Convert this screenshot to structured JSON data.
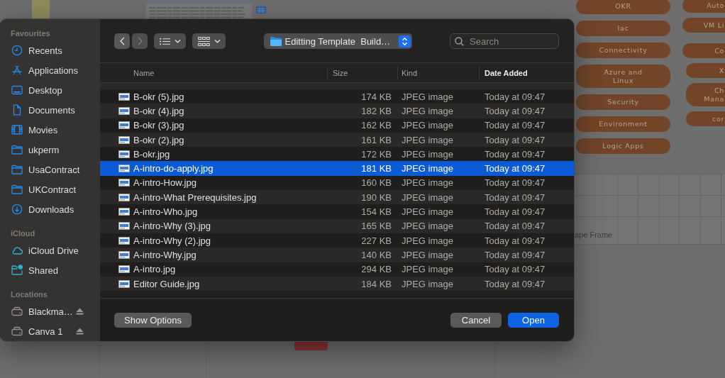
{
  "canvas": {
    "tags": [
      "OKR",
      "Iac",
      "Connectivity",
      "Azure and Linux",
      "Security",
      "Environment",
      "Logic Apps"
    ],
    "cut_tags": [
      "Auto",
      "VM Li",
      "Co",
      "X",
      "Ch Mana",
      "cor"
    ],
    "frame_label": "ape Frame"
  },
  "dialog": {
    "sidebar": [
      {
        "title": "Favourites",
        "items": [
          {
            "label": "Recents",
            "kind": "recents",
            "selected": false
          },
          {
            "label": "Applications",
            "kind": "applications",
            "selected": false
          },
          {
            "label": "Desktop",
            "kind": "desktop",
            "selected": false
          },
          {
            "label": "Documents",
            "kind": "documents",
            "selected": false
          },
          {
            "label": "Movies",
            "kind": "movies",
            "selected": false
          },
          {
            "label": "ukperm",
            "kind": "folder",
            "selected": false
          },
          {
            "label": "UsaContract",
            "kind": "folder",
            "selected": false
          },
          {
            "label": "UKContract",
            "kind": "folder",
            "selected": false
          },
          {
            "label": "Downloads",
            "kind": "downloads",
            "selected": false
          }
        ]
      },
      {
        "title": "iCloud",
        "items": [
          {
            "label": "iCloud Drive",
            "kind": "cloud",
            "selected": false
          },
          {
            "label": "Shared",
            "kind": "shared",
            "selected": false
          }
        ]
      },
      {
        "title": "Locations",
        "items": [
          {
            "label": "Blackma…",
            "kind": "drive",
            "selected": false
          },
          {
            "label": "Canva 1",
            "kind": "drive",
            "selected": false
          }
        ]
      }
    ],
    "toolbar": {
      "navigation": [
        {
          "kind": "back",
          "disabled": false
        },
        {
          "kind": "forward",
          "disabled": true
        }
      ],
      "location": "Editting Template  Build…",
      "search": {
        "placeholder": "Search"
      }
    },
    "columns": [
      {
        "label": "Name",
        "sorted": false
      },
      {
        "label": "Size",
        "sorted": false
      },
      {
        "label": "Kind",
        "sorted": false
      },
      {
        "label": "Date Added",
        "sorted": true
      }
    ],
    "rows": [
      {
        "name": "B-okr (5).jpg",
        "size": "174 KB",
        "kind": "JPEG image",
        "date": "Today at 09:47",
        "selected": false
      },
      {
        "name": "B-okr (4).jpg",
        "size": "182 KB",
        "kind": "JPEG image",
        "date": "Today at 09:47",
        "selected": false
      },
      {
        "name": "B-okr (3).jpg",
        "size": "162 KB",
        "kind": "JPEG image",
        "date": "Today at 09:47",
        "selected": false
      },
      {
        "name": "B-okr (2).jpg",
        "size": "161 KB",
        "kind": "JPEG image",
        "date": "Today at 09:47",
        "selected": false
      },
      {
        "name": "B-okr.jpg",
        "size": "172 KB",
        "kind": "JPEG image",
        "date": "Today at 09:47",
        "selected": false
      },
      {
        "name": "A-intro-do-apply.jpg",
        "size": "181 KB",
        "kind": "JPEG image",
        "date": "Today at 09:47",
        "selected": true
      },
      {
        "name": "A-intro-How.jpg",
        "size": "160 KB",
        "kind": "JPEG image",
        "date": "Today at 09:47",
        "selected": false
      },
      {
        "name": "A-intro-What Prerequisites.jpg",
        "size": "190 KB",
        "kind": "JPEG image",
        "date": "Today at 09:47",
        "selected": false
      },
      {
        "name": "A-intro-Who.jpg",
        "size": "154 KB",
        "kind": "JPEG image",
        "date": "Today at 09:47",
        "selected": false
      },
      {
        "name": "A-intro-Why (3).jpg",
        "size": "165 KB",
        "kind": "JPEG image",
        "date": "Today at 09:47",
        "selected": false
      },
      {
        "name": "A-intro-Why (2).jpg",
        "size": "227 KB",
        "kind": "JPEG image",
        "date": "Today at 09:47",
        "selected": false
      },
      {
        "name": "A-intro-Why.jpg",
        "size": "140 KB",
        "kind": "JPEG image",
        "date": "Today at 09:47",
        "selected": false
      },
      {
        "name": "A-intro.jpg",
        "size": "294 KB",
        "kind": "JPEG image",
        "date": "Today at 09:47",
        "selected": false
      },
      {
        "name": "Editor Guide.jpg",
        "size": "184 KB",
        "kind": "JPEG image",
        "date": "Today at 09:47",
        "selected": false
      }
    ],
    "footer": {
      "options_button": "Show Options",
      "buttons": [
        {
          "label": "Cancel",
          "kind": "plain"
        },
        {
          "label": "Open",
          "kind": "default"
        }
      ]
    }
  }
}
